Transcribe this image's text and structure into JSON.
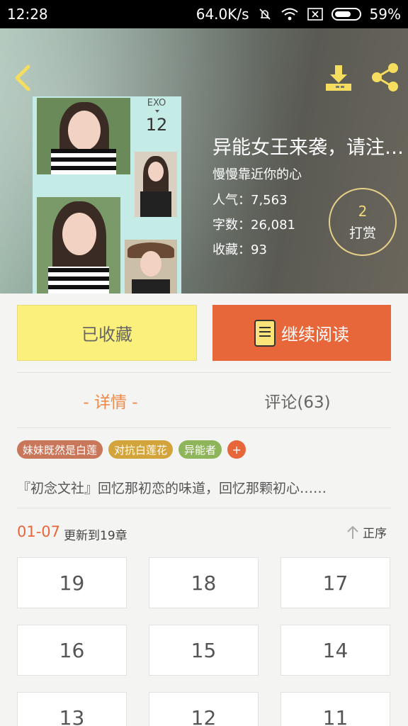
{
  "status_bar": {
    "time": "12:28",
    "net_speed": "64.0K/s",
    "battery": "59%"
  },
  "header": {
    "back_icon": "chevron-left-icon",
    "download_icon": "download-icon",
    "share_icon": "share-icon"
  },
  "cover": {
    "exo_text": "EXO",
    "number_text": "12"
  },
  "book": {
    "title": "异能女王来袭，请注…",
    "author": "慢慢靠近你的心",
    "popularity": "人气：7,563",
    "word_count": "字数：26,081",
    "favorites": "收藏：93",
    "tip_count": "2",
    "tip_label": "打赏"
  },
  "actions": {
    "favorite_label": "已收藏",
    "read_label": "继续阅读"
  },
  "tabs": {
    "detail": "- 详情 -",
    "comments": "评论(63)"
  },
  "tags": [
    {
      "label": "妹妹既然是白莲",
      "color": "#c8775a"
    },
    {
      "label": "对抗白莲花",
      "color": "#d3a43b"
    },
    {
      "label": "异能者",
      "color": "#8fb55a"
    }
  ],
  "tag_add_label": "+",
  "intro": "『初念文社』回忆那初恋的味道，回忆那颗初心……",
  "update": {
    "date": "01-07",
    "text": "更新到19章",
    "sort_label": "正序"
  },
  "chapters": [
    "19",
    "18",
    "17",
    "16",
    "15",
    "14",
    "13",
    "12",
    "11"
  ],
  "colors": {
    "accent": "#e8673a",
    "favorite_bg": "#fbf07c",
    "tab_active": "#f08a4b"
  }
}
